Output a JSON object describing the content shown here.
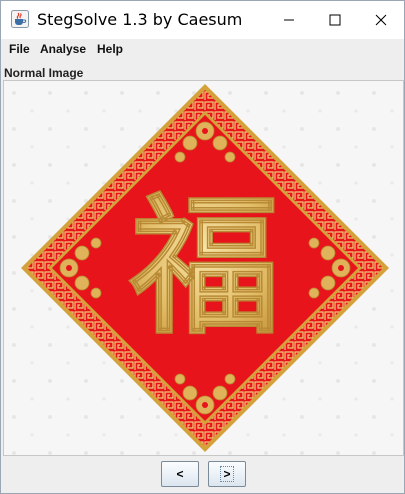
{
  "window": {
    "title": "StegSolve 1.3 by Caesum",
    "controls": [
      "minimize",
      "maximize",
      "close"
    ]
  },
  "menu": {
    "items": [
      "File",
      "Analyse",
      "Help"
    ]
  },
  "panel": {
    "label": "Normal Image",
    "image_text": "福"
  },
  "nav": {
    "prev_label": "<",
    "next_label": ">"
  },
  "colors": {
    "red": "#e8141c",
    "gold": "#d4a13a",
    "gold_light": "#f3d98d",
    "background": "#f6f6f6"
  },
  "icons": {
    "app": "java-coffee-icon",
    "minimize": "minimize-icon",
    "maximize": "maximize-icon",
    "close": "close-icon"
  }
}
